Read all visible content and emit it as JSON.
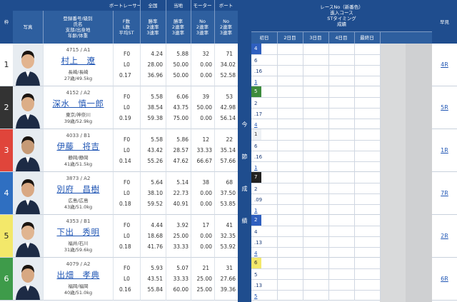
{
  "header": {
    "waku": "枠",
    "boat_racer": "ボートレーサー",
    "photo": "写真",
    "reg_lines": [
      "登録番号/級別",
      "氏名",
      "支部/出身地",
      "年齢/体重"
    ],
    "f_lines": [
      "F数",
      "L数",
      "平均ST"
    ],
    "zenkoku": "全国",
    "zenkoku_lines": [
      "勝率",
      "2連率",
      "3連率"
    ],
    "touchi": "当地",
    "touchi_lines": [
      "勝率",
      "2連率",
      "3連率"
    ],
    "motor": "モーター",
    "motor_lines": [
      "No",
      "2連率",
      "3連率"
    ],
    "boat": "ボート",
    "boat_lines": [
      "No",
      "2連率",
      "3連率"
    ],
    "race_lines": [
      "レースNo（新番色）",
      "進入コース",
      "STタイミング",
      "成績"
    ],
    "days": [
      "初日",
      "2日目",
      "3日目",
      "4日目",
      "最終日"
    ],
    "hayami": "早見",
    "konsetsu": [
      "今",
      "節",
      "成",
      "績"
    ]
  },
  "racers": [
    {
      "waku": "1",
      "color": "#ffffff",
      "text_color": "#222",
      "reg": "4715 / A1",
      "name": "村上　遼",
      "area": "長崎/長崎",
      "age_weight": "27歳/49.5kg",
      "f": "F0",
      "l": "L0",
      "st": "0.17",
      "z1": "4.24",
      "z2": "28.00",
      "z3": "36.96",
      "t1": "5.88",
      "t2": "50.00",
      "t3": "50.00",
      "m1": "32",
      "m2": "0.00",
      "m3": "0.00",
      "b1": "71",
      "b2": "34.02",
      "b3": "52.58",
      "course": {
        "race": "4",
        "entry": "6",
        "st": ".16",
        "result": "1"
      },
      "race_bg": "blue",
      "hayami": "4R"
    },
    {
      "waku": "2",
      "color": "#333333",
      "text_color": "#fff",
      "reg": "4152 / A2",
      "name": "深水　慎一郎",
      "area": "東京/神奈川",
      "age_weight": "39歳/52.9kg",
      "f": "F0",
      "l": "L0",
      "st": "0.19",
      "z1": "5.58",
      "z2": "38.54",
      "z3": "59.38",
      "t1": "6.06",
      "t2": "43.75",
      "t3": "75.00",
      "m1": "39",
      "m2": "50.00",
      "m3": "0.00",
      "b1": "53",
      "b2": "42.98",
      "b3": "56.14",
      "course": {
        "race": "5",
        "entry": "2",
        "st": ".17",
        "result": "4"
      },
      "race_bg": "green",
      "hayami": "5R"
    },
    {
      "waku": "3",
      "color": "#e0453b",
      "text_color": "#fff",
      "reg": "4033 / B1",
      "name": "伊藤　将吉",
      "area": "静岡/静岡",
      "age_weight": "41歳/51.5kg",
      "f": "F0",
      "l": "L0",
      "st": "0.14",
      "z1": "5.58",
      "z2": "43.42",
      "z3": "55.26",
      "t1": "5.86",
      "t2": "28.57",
      "t3": "47.62",
      "m1": "12",
      "m2": "33.33",
      "m3": "66.67",
      "b1": "22",
      "b2": "35.14",
      "b3": "57.66",
      "course": {
        "race": "1",
        "entry": "6",
        "st": ".16",
        "result": "1"
      },
      "race_bg": "white",
      "hayami": "1R"
    },
    {
      "waku": "4",
      "color": "#2f6fc1",
      "text_color": "#fff",
      "reg": "3873 / A2",
      "name": "別府　昌樹",
      "area": "広島/広島",
      "age_weight": "43歳/51.0kg",
      "f": "F0",
      "l": "L0",
      "st": "0.18",
      "z1": "5.64",
      "z2": "38.10",
      "z3": "59.52",
      "t1": "5.14",
      "t2": "22.73",
      "t3": "40.91",
      "m1": "38",
      "m2": "0.00",
      "m3": "0.00",
      "b1": "68",
      "b2": "37.50",
      "b3": "53.85",
      "course": {
        "race": "7",
        "entry": "2",
        "st": ".09",
        "result": "1"
      },
      "race_bg": "black",
      "hayami": "7R"
    },
    {
      "waku": "5",
      "color": "#f3e86a",
      "text_color": "#222",
      "reg": "4353 / B1",
      "name": "下出　秀明",
      "area": "福井/石川",
      "age_weight": "31歳/59.6kg",
      "f": "F0",
      "l": "L0",
      "st": "0.18",
      "z1": "4.44",
      "z2": "18.68",
      "z3": "41.76",
      "t1": "3.92",
      "t2": "25.00",
      "t3": "33.33",
      "m1": "17",
      "m2": "0.00",
      "m3": "0.00",
      "b1": "41",
      "b2": "32.35",
      "b3": "53.92",
      "course": {
        "race": "2",
        "entry": "4",
        "st": ".13",
        "result": "4"
      },
      "race_bg": "blue",
      "hayami": "2R"
    },
    {
      "waku": "6",
      "color": "#3e9b4a",
      "text_color": "#fff",
      "reg": "4079 / A2",
      "name": "出畑　孝典",
      "area": "福岡/福岡",
      "age_weight": "40歳/51.0kg",
      "f": "F0",
      "l": "L0",
      "st": "0.16",
      "z1": "5.93",
      "z2": "43.51",
      "z3": "55.84",
      "t1": "5.07",
      "t2": "33.33",
      "t3": "60.00",
      "m1": "21",
      "m2": "25.00",
      "m3": "25.00",
      "b1": "31",
      "b2": "27.66",
      "b3": "39.36",
      "course": {
        "race": "6",
        "entry": "5",
        "st": ".13",
        "result": "5"
      },
      "race_bg": "yellow",
      "hayami": "6R"
    }
  ]
}
